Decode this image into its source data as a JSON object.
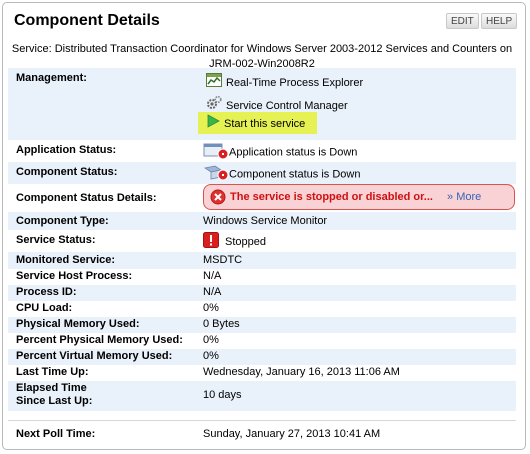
{
  "header": {
    "title": "Component Details",
    "edit_label": "EDIT",
    "help_label": "HELP",
    "service_line_1": "Service: Distributed Transaction Coordinator for Windows Server 2003-2012 Services and Counters on",
    "service_line_2": "JRM-002-Win2008R2"
  },
  "management": {
    "label": "Management:",
    "links": [
      {
        "label": "Real-Time Process Explorer",
        "icon": "process-explorer-icon"
      },
      {
        "label": "Service Control Manager",
        "icon": "gear-icon"
      },
      {
        "label": "Start this service",
        "icon": "play-icon"
      }
    ]
  },
  "details": {
    "application_status": {
      "label": "Application Status:",
      "value": "Application status is Down"
    },
    "component_status": {
      "label": "Component Status:",
      "value": "Component status is Down"
    },
    "component_status_details": {
      "label": "Component Status Details:",
      "error_text": "The service is stopped or disabled or...",
      "more_label": "More",
      "more_prefix": "»"
    },
    "component_type": {
      "label": "Component Type:",
      "value": "Windows Service Monitor"
    },
    "service_status": {
      "label": "Service Status:",
      "value": "Stopped"
    },
    "monitored_service": {
      "label": "Monitored Service:",
      "value": "MSDTC"
    },
    "service_host_process": {
      "label": "Service Host Process:",
      "value": "N/A"
    },
    "process_id": {
      "label": "Process ID:",
      "value": "N/A"
    },
    "cpu_load": {
      "label": "CPU Load:",
      "value": "0%"
    },
    "physical_memory_used": {
      "label": "Physical Memory Used:",
      "value": "0 Bytes"
    },
    "percent_physical_memory_used": {
      "label": "Percent Physical Memory Used:",
      "value": "0%"
    },
    "percent_virtual_memory_used": {
      "label": "Percent Virtual Memory Used:",
      "value": "0%"
    },
    "last_time_up": {
      "label": "Last Time Up:",
      "value": "Wednesday, January 16, 2013 11:06 AM"
    },
    "elapsed_time": {
      "label_1": "Elapsed Time",
      "label_2": "Since Last Up:",
      "value": "10 days"
    },
    "next_poll_time": {
      "label": "Next Poll Time:",
      "value": "Sunday, January 27, 2013 10:41 AM"
    }
  },
  "colors": {
    "alt_row": "#e9f1fa",
    "highlight": "#e6f254",
    "error_text": "#d01010",
    "error_bg": "#f8d2d4",
    "link_more": "#3a63b8"
  }
}
